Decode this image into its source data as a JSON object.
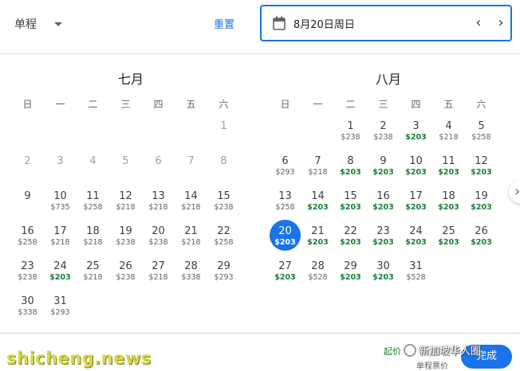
{
  "topbar": {
    "trip_type": "单程",
    "reset_label": "重置",
    "date_value": "8月20日周日",
    "prev_symbol": "‹",
    "next_symbol": "›"
  },
  "weekdays": [
    "日",
    "一",
    "二",
    "三",
    "四",
    "五",
    "六"
  ],
  "months": [
    {
      "title": "七月",
      "offset": 6,
      "days": [
        {
          "d": "1",
          "p": "",
          "past": true
        },
        {
          "d": "2",
          "p": "",
          "past": true
        },
        {
          "d": "3",
          "p": "",
          "past": true
        },
        {
          "d": "4",
          "p": "",
          "past": true
        },
        {
          "d": "5",
          "p": "",
          "past": true
        },
        {
          "d": "6",
          "p": "",
          "past": true
        },
        {
          "d": "7",
          "p": "",
          "past": true
        },
        {
          "d": "8",
          "p": "",
          "past": true
        },
        {
          "d": "9",
          "p": ""
        },
        {
          "d": "10",
          "p": "$735"
        },
        {
          "d": "11",
          "p": "$258"
        },
        {
          "d": "12",
          "p": "$218"
        },
        {
          "d": "13",
          "p": "$218"
        },
        {
          "d": "14",
          "p": "$218"
        },
        {
          "d": "15",
          "p": "$238"
        },
        {
          "d": "16",
          "p": "$258"
        },
        {
          "d": "17",
          "p": "$218"
        },
        {
          "d": "18",
          "p": "$218"
        },
        {
          "d": "19",
          "p": "$238"
        },
        {
          "d": "20",
          "p": "$238"
        },
        {
          "d": "21",
          "p": "$218"
        },
        {
          "d": "22",
          "p": "$258"
        },
        {
          "d": "23",
          "p": "$238"
        },
        {
          "d": "24",
          "p": "$203",
          "low": true
        },
        {
          "d": "25",
          "p": "$218"
        },
        {
          "d": "26",
          "p": "$238"
        },
        {
          "d": "27",
          "p": "$218"
        },
        {
          "d": "28",
          "p": "$338"
        },
        {
          "d": "29",
          "p": "$293"
        },
        {
          "d": "30",
          "p": "$338"
        },
        {
          "d": "31",
          "p": "$293"
        }
      ]
    },
    {
      "title": "八月",
      "offset": 2,
      "days": [
        {
          "d": "1",
          "p": "$238"
        },
        {
          "d": "2",
          "p": "$238"
        },
        {
          "d": "3",
          "p": "$203",
          "low": true
        },
        {
          "d": "4",
          "p": "$218"
        },
        {
          "d": "5",
          "p": "$258"
        },
        {
          "d": "6",
          "p": "$293"
        },
        {
          "d": "7",
          "p": "$218"
        },
        {
          "d": "8",
          "p": "$203",
          "low": true
        },
        {
          "d": "9",
          "p": "$203",
          "low": true
        },
        {
          "d": "10",
          "p": "$203",
          "low": true
        },
        {
          "d": "11",
          "p": "$203",
          "low": true
        },
        {
          "d": "12",
          "p": "$203",
          "low": true
        },
        {
          "d": "13",
          "p": "$258"
        },
        {
          "d": "14",
          "p": "$203",
          "low": true
        },
        {
          "d": "15",
          "p": "$203",
          "low": true
        },
        {
          "d": "16",
          "p": "$203",
          "low": true
        },
        {
          "d": "17",
          "p": "$203",
          "low": true
        },
        {
          "d": "18",
          "p": "$203",
          "low": true
        },
        {
          "d": "19",
          "p": "$203",
          "low": true
        },
        {
          "d": "20",
          "p": "$203",
          "low": true,
          "selected": true
        },
        {
          "d": "21",
          "p": "$203",
          "low": true
        },
        {
          "d": "22",
          "p": "$203",
          "low": true
        },
        {
          "d": "23",
          "p": "$203",
          "low": true
        },
        {
          "d": "24",
          "p": "$203",
          "low": true
        },
        {
          "d": "25",
          "p": "$203",
          "low": true
        },
        {
          "d": "26",
          "p": "$203",
          "low": true
        },
        {
          "d": "27",
          "p": "$203",
          "low": true
        },
        {
          "d": "28",
          "p": "$528"
        },
        {
          "d": "29",
          "p": "$203",
          "low": true
        },
        {
          "d": "30",
          "p": "$203",
          "low": true
        },
        {
          "d": "31",
          "p": "$528"
        }
      ]
    }
  ],
  "footer": {
    "from_label": "起价",
    "fare_label": "单程票价",
    "done_label": "完成"
  },
  "watermark": {
    "left_text": "shicheng.news",
    "right_text": "新加坡华人圈"
  },
  "colors": {
    "accent": "#1a73e8",
    "low_price": "#188038",
    "text": "#3c4043"
  }
}
